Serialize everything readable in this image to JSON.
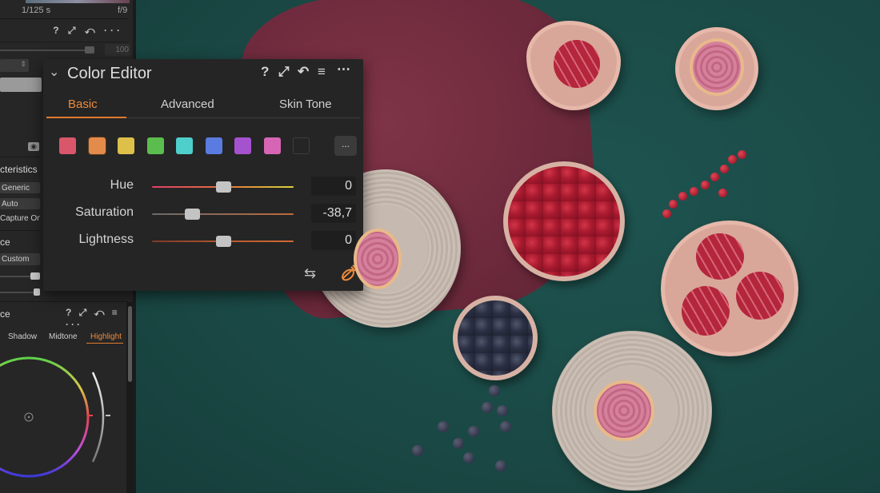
{
  "sidebar": {
    "exif": {
      "shutter": "1/125 s",
      "aperture": "f/9"
    },
    "tool1": {
      "header_icons": "? ⤢ ↶ ···",
      "slider_value": "100"
    },
    "characteristics": {
      "title": "cteristics",
      "curve": "Generic",
      "engine": "Auto",
      "profile": "Capture On"
    },
    "white_balance": {
      "title": "ce",
      "mode": "Custom"
    },
    "color_balance": {
      "title": "ce",
      "header_icons": "? ⤢ ↶ ≡ ···",
      "tabs": [
        {
          "label": "Shadow",
          "active": false
        },
        {
          "label": "Midtone",
          "active": false
        },
        {
          "label": "Highlight",
          "active": true
        }
      ]
    }
  },
  "color_editor": {
    "title": "Color Editor",
    "header_icons": {
      "help": "?",
      "float": "⤢",
      "reset": "↶",
      "presets": "≡",
      "more": "⋯"
    },
    "tabs": [
      {
        "label": "Basic",
        "active": true
      },
      {
        "label": "Advanced",
        "active": false
      },
      {
        "label": "Skin Tone",
        "active": false
      }
    ],
    "swatches": [
      {
        "name": "red",
        "color": "#d9566b"
      },
      {
        "name": "orange",
        "color": "#e38b4b",
        "selected": true
      },
      {
        "name": "yellow",
        "color": "#dcc04a"
      },
      {
        "name": "green",
        "color": "#5cbd4f"
      },
      {
        "name": "cyan",
        "color": "#4fcfcb"
      },
      {
        "name": "blue",
        "color": "#5a7be0"
      },
      {
        "name": "purple",
        "color": "#a552cf"
      },
      {
        "name": "magenta",
        "color": "#d666b5"
      },
      {
        "name": "empty",
        "color": "#252525"
      }
    ],
    "more_swatches_label": "...",
    "sliders": [
      {
        "label": "Hue",
        "value": "0",
        "position": 0.5
      },
      {
        "label": "Saturation",
        "value": "-38,7",
        "position": 0.28
      },
      {
        "label": "Lightness",
        "value": "0",
        "position": 0.5
      }
    ],
    "accent_color": "#ec8a3c"
  }
}
